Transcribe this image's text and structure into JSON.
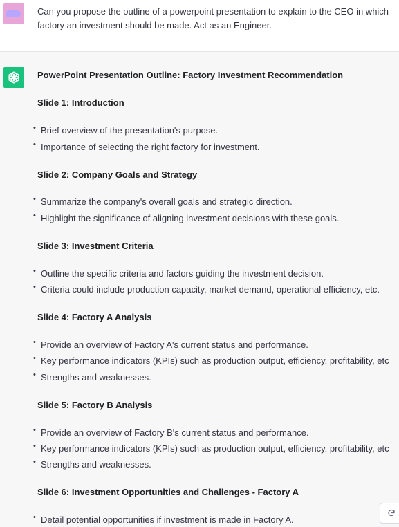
{
  "user_message": {
    "text": "Can you propose the outline of a powerpoint presentation to explain to the CEO in which factory an investment should be made. Act as an Engineer.",
    "avatar_icon": "user-avatar"
  },
  "assistant": {
    "avatar_icon": "openai-logo-icon",
    "title": "PowerPoint Presentation Outline: Factory Investment Recommendation",
    "slides": [
      {
        "heading": "Slide 1: Introduction",
        "bullets": [
          "Brief overview of the presentation's purpose.",
          "Importance of selecting the right factory for investment."
        ]
      },
      {
        "heading": "Slide 2: Company Goals and Strategy",
        "bullets": [
          "Summarize the company's overall goals and strategic direction.",
          "Highlight the significance of aligning investment decisions with these goals."
        ]
      },
      {
        "heading": "Slide 3: Investment Criteria",
        "bullets": [
          "Outline the specific criteria and factors guiding the investment decision.",
          "Criteria could include production capacity, market demand, operational efficiency, etc."
        ]
      },
      {
        "heading": "Slide 4: Factory A Analysis",
        "bullets": [
          "Provide an overview of Factory A's current status and performance.",
          "Key performance indicators (KPIs) such as production output, efficiency, profitability, etc",
          "Strengths and weaknesses."
        ]
      },
      {
        "heading": "Slide 5: Factory B Analysis",
        "bullets": [
          "Provide an overview of Factory B's current status and performance.",
          "Key performance indicators (KPIs) such as production output, efficiency, profitability, etc",
          "Strengths and weaknesses."
        ]
      },
      {
        "heading": "Slide 6: Investment Opportunities and Challenges - Factory A",
        "bullets": [
          "Detail potential opportunities if investment is made in Factory A."
        ]
      }
    ]
  },
  "controls": {
    "regenerate_icon": "refresh-icon"
  },
  "colors": {
    "assistant_bg": "#f7f7f8",
    "user_bg": "#ffffff",
    "gpt_green": "#19c37d",
    "text": "#343541"
  }
}
